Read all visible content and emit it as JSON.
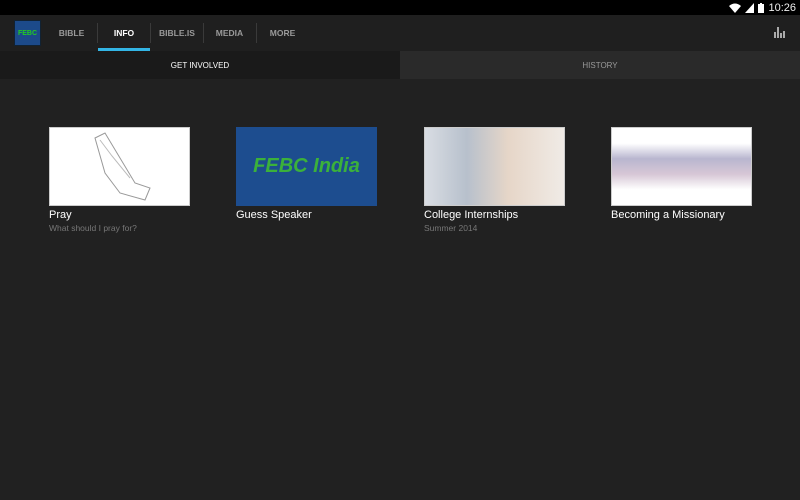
{
  "status_bar": {
    "time": "10:26",
    "icons": [
      "wifi-icon",
      "signal-icon",
      "battery-icon"
    ]
  },
  "action_bar": {
    "logo_text": "FEBC",
    "tabs": [
      {
        "label": "BIBLE"
      },
      {
        "label": "INFO",
        "active": true
      },
      {
        "label": "BIBLE.IS"
      },
      {
        "label": "MEDIA"
      },
      {
        "label": "MORE"
      }
    ],
    "accent": "#33b5e5",
    "right_icon": "bar-chart-icon"
  },
  "sub_tabs": [
    {
      "label": "GET INVOLVED",
      "selected": true
    },
    {
      "label": "HISTORY"
    }
  ],
  "cards": [
    {
      "title": "Pray",
      "subtitle": "What should I pray for?",
      "image": "praying-hands-sketch"
    },
    {
      "title": "Guess Speaker",
      "subtitle": "",
      "image": "febc-india-logo",
      "image_text": "FEBC India"
    },
    {
      "title": "College Internships",
      "subtitle": "Summer 2014",
      "image": "students-photo"
    },
    {
      "title": "Becoming a Missionary",
      "subtitle": "",
      "image": "sky-clouds-photo"
    }
  ]
}
